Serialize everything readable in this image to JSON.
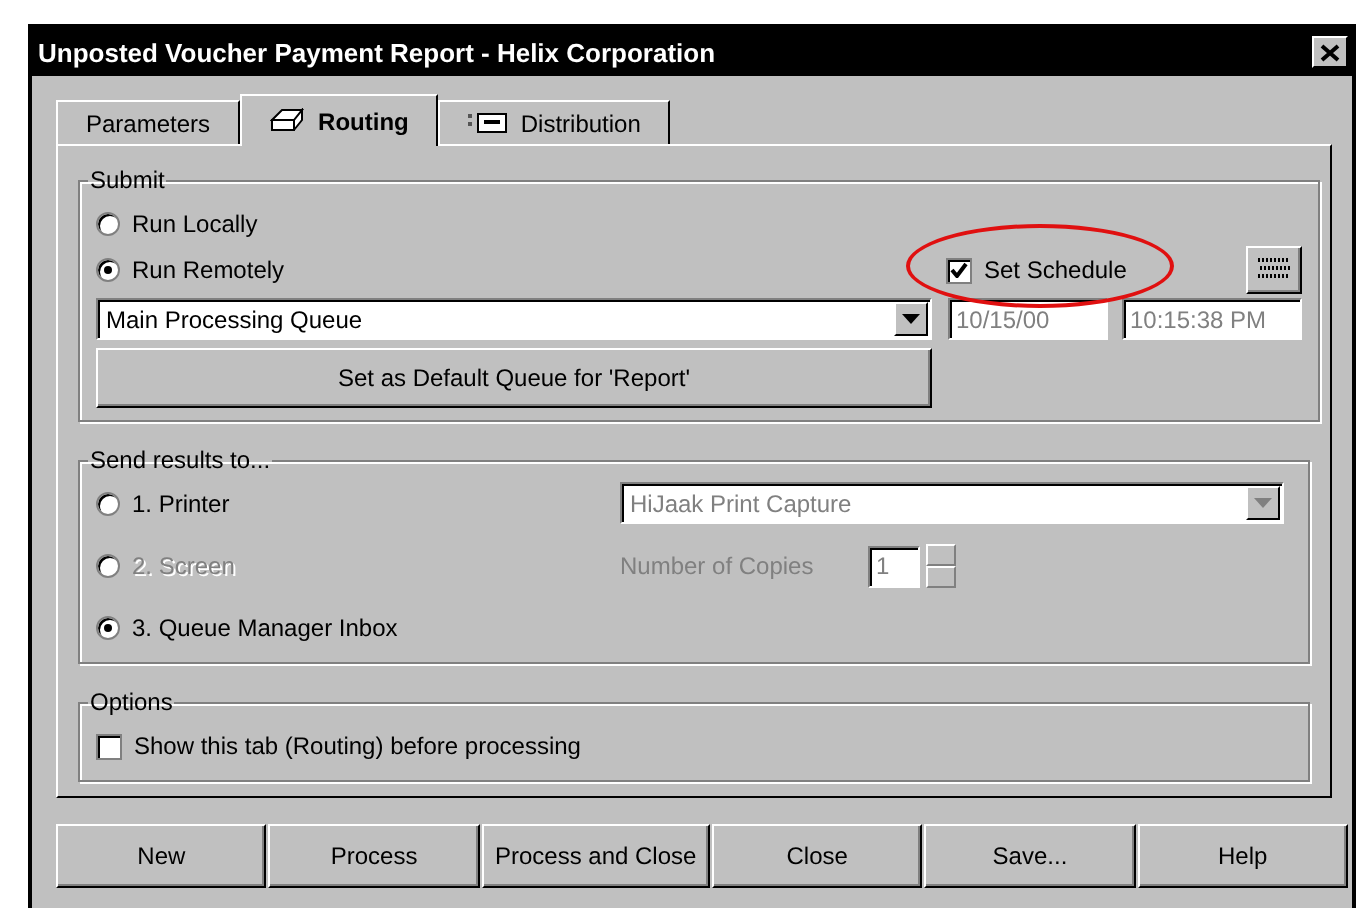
{
  "window": {
    "title": "Unposted Voucher Payment Report - Helix Corporation"
  },
  "tabs": [
    {
      "label": "Parameters",
      "selected": false,
      "kind": "plain"
    },
    {
      "label": "Routing",
      "selected": true,
      "kind": "print"
    },
    {
      "label": "Distribution",
      "selected": false,
      "kind": "list"
    }
  ],
  "submit": {
    "title": "Submit",
    "modes": [
      {
        "label": "Run Locally",
        "selected": false
      },
      {
        "label": "Run Remotely",
        "selected": true
      }
    ],
    "set_schedule": {
      "label": "Set Schedule",
      "checked": true,
      "circled": true
    },
    "queue": {
      "value": "Main Processing Queue"
    },
    "date": {
      "value": "10/15/00",
      "disabled": true
    },
    "time": {
      "value": "10:15:38 PM",
      "disabled": true
    },
    "default_button": "Set as Default Queue for 'Report'"
  },
  "send_results": {
    "title": "Send results to...",
    "destinations": [
      {
        "label": "1. Printer",
        "selected": false,
        "disabled": false
      },
      {
        "label": "2. Screen",
        "selected": false,
        "disabled": true
      },
      {
        "label": "3. Queue Manager Inbox",
        "selected": true,
        "disabled": false
      }
    ],
    "printer": {
      "value": "HiJaak Print Capture",
      "disabled": true
    },
    "copies": {
      "label": "Number of Copies",
      "value": "1",
      "disabled": true
    }
  },
  "options": {
    "title": "Options",
    "items": [
      {
        "label": "Show this tab (Routing) before processing",
        "checked": false
      }
    ]
  },
  "buttons": [
    "New",
    "Process",
    "Process and Close",
    "Close",
    "Save...",
    "Help"
  ]
}
